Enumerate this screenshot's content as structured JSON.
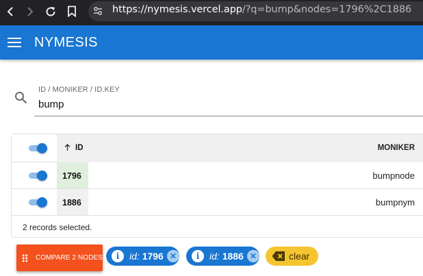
{
  "browser": {
    "url_host": "https://nymesis.vercel.app",
    "url_rest": "/?q=bump&nodes=1796%2C1886"
  },
  "app": {
    "title": "NYMESIS"
  },
  "search": {
    "label": "ID / MONIKER / ID.KEY",
    "value": "bump"
  },
  "table": {
    "columns": {
      "id": "ID",
      "moniker": "MONIKER"
    },
    "rows": [
      {
        "id": "1796",
        "moniker": "bumpnode",
        "selected": true
      },
      {
        "id": "1886",
        "moniker": "bumpnym",
        "selected": true
      }
    ],
    "footer": "2 records selected."
  },
  "actions": {
    "compare_label": "COMPARE 2 NODES",
    "chips": [
      {
        "key": "id:",
        "value": "1796"
      },
      {
        "key": "id:",
        "value": "1886"
      }
    ],
    "clear_label": "clear"
  },
  "colors": {
    "primary": "#1976d2",
    "accent": "#f4511e",
    "clear_chip": "#f5c431"
  }
}
